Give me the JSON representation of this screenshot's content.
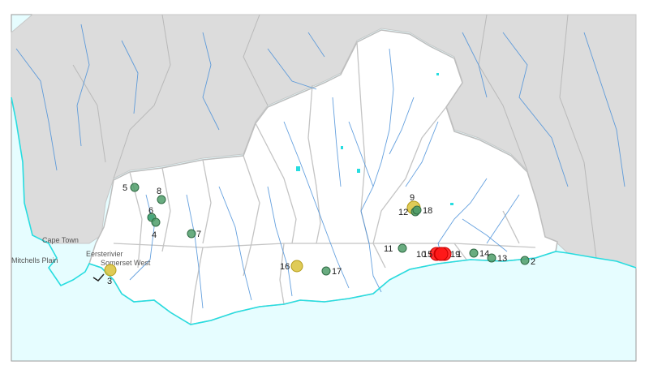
{
  "map": {
    "place_labels": {
      "cape_town": "Cape Town",
      "mitchells_plain": "Mitchells Plain",
      "eersterivier": "Eersterivier",
      "somerset_west": "Somerset West"
    },
    "colors": {
      "land_outside": "#dcdcdc",
      "region": "#ffffff",
      "sea": "#e6fdff",
      "coast": "#27dde0",
      "river": "#4a90d9",
      "boundary": "#bdbdbd",
      "marker_green": "#4f9e6a",
      "marker_yellow": "#d9c23a",
      "marker_red": "#ff1a1a"
    },
    "markers": [
      {
        "label": "1",
        "color": "red"
      },
      {
        "label": "2",
        "color": "green"
      },
      {
        "label": "3",
        "color": "yellow"
      },
      {
        "label": "4",
        "color": "green"
      },
      {
        "label": "5",
        "color": "green"
      },
      {
        "label": "6",
        "color": "green"
      },
      {
        "label": "7",
        "color": "green"
      },
      {
        "label": "8",
        "color": "green"
      },
      {
        "label": "9",
        "color": "yellow"
      },
      {
        "label": "10",
        "color": "red"
      },
      {
        "label": "11",
        "color": "green"
      },
      {
        "label": "12",
        "color": "green"
      },
      {
        "label": "13",
        "color": "green"
      },
      {
        "label": "14",
        "color": "green"
      },
      {
        "label": "15",
        "color": "red"
      },
      {
        "label": "16",
        "color": "yellow"
      },
      {
        "label": "17",
        "color": "green"
      },
      {
        "label": "18",
        "color": "green"
      },
      {
        "label": "19",
        "color": "red"
      }
    ]
  }
}
